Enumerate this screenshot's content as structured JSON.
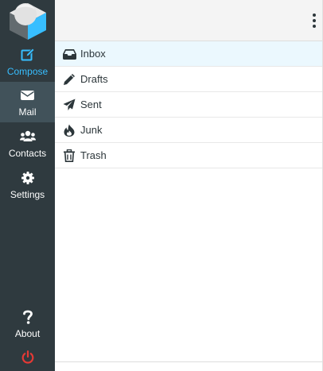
{
  "sidebar": {
    "items": [
      {
        "label": "Compose",
        "icon": "compose-icon",
        "active_color": "#37beff"
      },
      {
        "label": "Mail",
        "icon": "envelope-icon",
        "selected": true
      },
      {
        "label": "Contacts",
        "icon": "users-icon"
      },
      {
        "label": "Settings",
        "icon": "gear-icon"
      }
    ],
    "about": {
      "label": "About",
      "icon": "question-icon"
    },
    "logout": {
      "icon": "power-icon",
      "color": "#e53935"
    }
  },
  "header": {
    "menu_icon": "vertical-ellipsis-icon"
  },
  "folders": [
    {
      "label": "Inbox",
      "icon": "inbox-icon",
      "selected": true
    },
    {
      "label": "Drafts",
      "icon": "pencil-icon"
    },
    {
      "label": "Sent",
      "icon": "paper-plane-icon"
    },
    {
      "label": "Junk",
      "icon": "fire-icon"
    },
    {
      "label": "Trash",
      "icon": "trash-icon"
    }
  ],
  "colors": {
    "sidebar_bg": "#2f3a3f",
    "sidebar_selected_bg": "#41525a",
    "accent": "#37beff",
    "selected_row_bg": "#ebf8fe"
  }
}
